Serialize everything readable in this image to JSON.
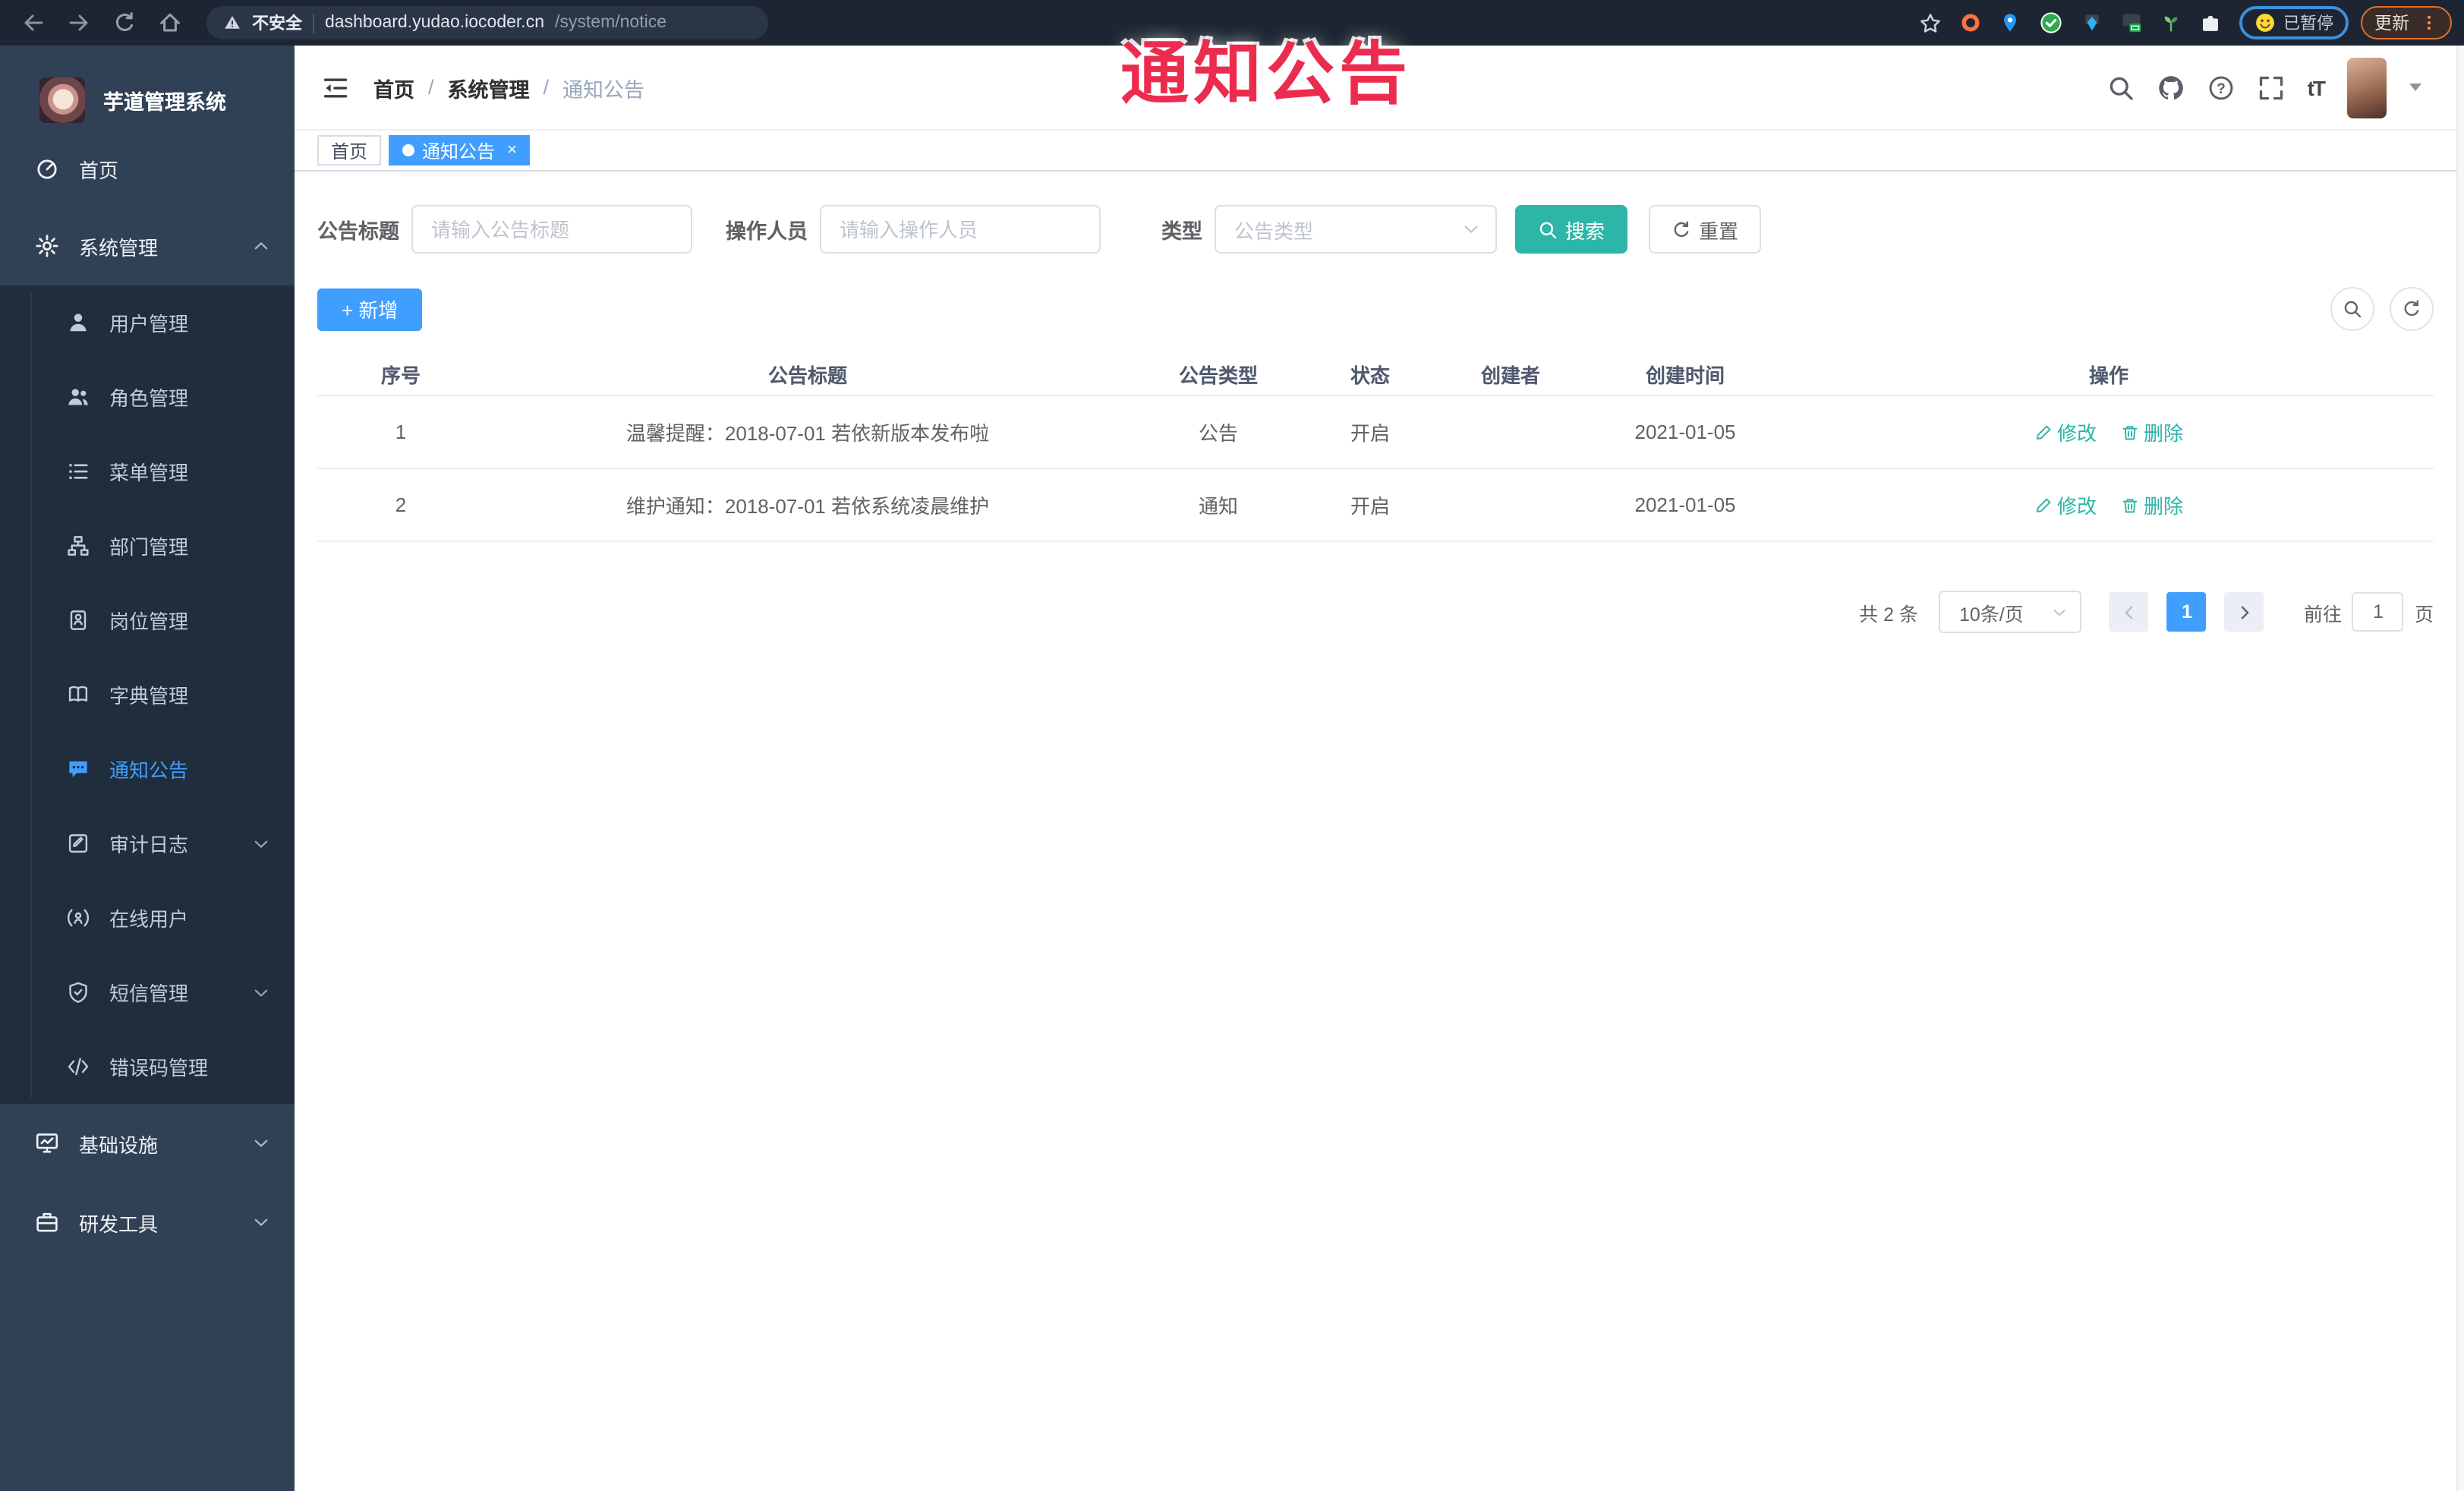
{
  "browser": {
    "security_label": "不安全",
    "url_host": "dashboard.yudao.iocoder.cn",
    "url_path": "/system/notice",
    "paused_label": "已暂停",
    "update_label": "更新"
  },
  "watermark": "通知公告",
  "sidebar": {
    "title": "芋道管理系统",
    "items": [
      {
        "label": "首页"
      },
      {
        "label": "系统管理"
      },
      {
        "label": "用户管理"
      },
      {
        "label": "角色管理"
      },
      {
        "label": "菜单管理"
      },
      {
        "label": "部门管理"
      },
      {
        "label": "岗位管理"
      },
      {
        "label": "字典管理"
      },
      {
        "label": "通知公告"
      },
      {
        "label": "审计日志"
      },
      {
        "label": "在线用户"
      },
      {
        "label": "短信管理"
      },
      {
        "label": "错误码管理"
      },
      {
        "label": "基础设施"
      },
      {
        "label": "研发工具"
      }
    ]
  },
  "header": {
    "breadcrumb": [
      "首页",
      "系统管理",
      "通知公告"
    ],
    "separator": "/"
  },
  "tags": {
    "home": "首页",
    "active": "通知公告",
    "close": "×"
  },
  "filters": {
    "title_label": "公告标题",
    "title_placeholder": "请输入公告标题",
    "operator_label": "操作人员",
    "operator_placeholder": "请输入操作人员",
    "type_label": "类型",
    "type_placeholder": "公告类型",
    "search_label": "搜索",
    "reset_label": "重置"
  },
  "toolbar": {
    "add_label": "+ 新增"
  },
  "table": {
    "columns": [
      "序号",
      "公告标题",
      "公告类型",
      "状态",
      "创建者",
      "创建时间",
      "操作"
    ],
    "rows": [
      {
        "no": "1",
        "title": "温馨提醒：2018-07-01 若依新版本发布啦",
        "type": "公告",
        "status": "开启",
        "creator": "",
        "time": "2021-01-05"
      },
      {
        "no": "2",
        "title": "维护通知：2018-07-01 若依系统凌晨维护",
        "type": "通知",
        "status": "开启",
        "creator": "",
        "time": "2021-01-05"
      }
    ],
    "edit_label": "修改",
    "delete_label": "删除"
  },
  "pagination": {
    "total": "共 2 条",
    "page_size": "10条/页",
    "current": "1",
    "goto_label": "前往",
    "goto_value": "1",
    "page_unit": "页"
  },
  "colors": {
    "accent_blue": "#409eff",
    "teal": "#2bb6a8",
    "watermark_red": "#ec2c4f",
    "sidebar_bg": "#304156",
    "submenu_bg": "#1f2d3d",
    "chrome_bg": "#1c2531"
  }
}
